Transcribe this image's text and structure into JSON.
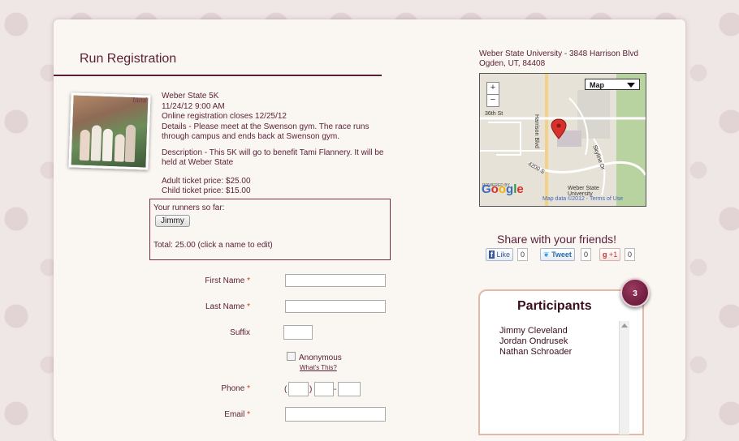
{
  "page": {
    "title": "Run Registration"
  },
  "event": {
    "name": "Weber State 5K",
    "datetime": "11/24/12 9:00 AM",
    "online_close": "Online registration closes 12/25/12",
    "details": "Details - Please meet at the Swenson gym. The race runs through campus and ends back at Swenson gym.",
    "description": "Description - This 5K will go to benefit Tami Flannery. It will be held at Weber State",
    "adult_price": "Adult ticket price: $25.00",
    "child_price": "Child ticket price: $15.00",
    "photo_tag": "tami"
  },
  "runners": {
    "label": "Your runners so far:",
    "names": [
      "Jimmy"
    ],
    "total": "Total: 25.00 (click a name to edit)"
  },
  "form": {
    "first_name": {
      "label": "First Name",
      "required": "*",
      "value": ""
    },
    "last_name": {
      "label": "Last Name",
      "required": "*",
      "value": ""
    },
    "suffix": {
      "label": "Suffix",
      "value": ""
    },
    "anonymous": {
      "label": "Anonymous",
      "checked": false,
      "help_link": "What's This?"
    },
    "phone": {
      "label": "Phone",
      "required": "*",
      "open_paren": "(",
      "close_paren": ")",
      "dash": "-"
    },
    "email": {
      "label": "Email",
      "required": "*",
      "value": ""
    }
  },
  "venue": {
    "line1": "Weber State University - 3848 Harrison Blvd",
    "line2": "Ogden, UT, 84408"
  },
  "map": {
    "type": "Map",
    "zoom_in": "+",
    "zoom_out": "−",
    "roads": [
      "36th St",
      "Harrison Blvd",
      "4200 S",
      "Skyline Dr",
      "Weber State University"
    ],
    "powered_by": "POWERED BY",
    "logo": "Google",
    "attribution": "Map data ©2012 - Terms of Use"
  },
  "share": {
    "title": "Share with your friends!",
    "like_label": "Like",
    "like_count": "0",
    "tweet_label": "Tweet",
    "tweet_count": "0",
    "gplus_label": "+1",
    "gplus_count": "0"
  },
  "participants": {
    "title": "Participants",
    "count": "3",
    "names": [
      "Jimmy Cleveland",
      "Jordan Ondrusek",
      "Nathan Schroader"
    ]
  }
}
